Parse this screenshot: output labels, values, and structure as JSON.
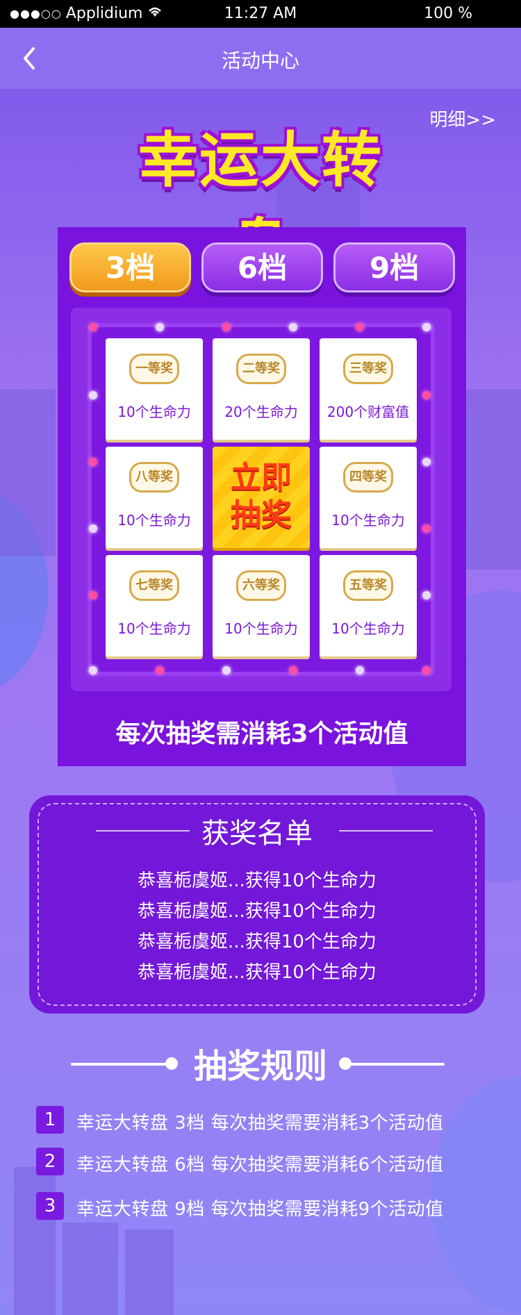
{
  "status_bar": {
    "carrier_dots": "●●●○○",
    "carrier": "Applidium",
    "time": "11:27 AM",
    "battery": "100 %"
  },
  "nav": {
    "back_icon": "chevron-left-icon",
    "title": "活动中心"
  },
  "header": {
    "detail_link": "明细>>",
    "logo_text": "幸运大转盘"
  },
  "tabs": [
    {
      "label": "3档",
      "active": true
    },
    {
      "label": "6档",
      "active": false
    },
    {
      "label": "9档",
      "active": false
    }
  ],
  "grid": {
    "cells": [
      {
        "badge": "一等奖",
        "prize": "10个生命力"
      },
      {
        "badge": "二等奖",
        "prize": "20个生命力"
      },
      {
        "badge": "三等奖",
        "prize": "200个财富值"
      },
      {
        "badge": "八等奖",
        "prize": "10个生命力"
      },
      {
        "badge": "四等奖",
        "prize": "10个生命力"
      },
      {
        "badge": "七等奖",
        "prize": "10个生命力"
      },
      {
        "badge": "六等奖",
        "prize": "10个生命力"
      },
      {
        "badge": "五等奖",
        "prize": "10个生命力"
      }
    ],
    "draw_button": {
      "line1": "立即",
      "line2": "抽奖"
    },
    "cost_text": "每次抽奖需消耗3个活动值"
  },
  "winners": {
    "title": "获奖名单",
    "rows": [
      "恭喜栀虞姬...获得10个生命力",
      "恭喜栀虞姬...获得10个生命力",
      "恭喜栀虞姬...获得10个生命力",
      "恭喜栀虞姬...获得10个生命力"
    ]
  },
  "rules": {
    "title": "抽奖规则",
    "items": [
      {
        "num": "1",
        "text": "幸运大转盘   3档   每次抽奖需要消耗3个活动值"
      },
      {
        "num": "2",
        "text": "幸运大转盘   6档   每次抽奖需要消耗6个活动值"
      },
      {
        "num": "3",
        "text": "幸运大转盘   9档   每次抽奖需要消耗9个活动值"
      }
    ]
  },
  "colors": {
    "panel": "#7a13dd",
    "active_tab": "#f19a1c",
    "draw_button": "#ffc410",
    "prize_text": "#7b17d6"
  }
}
